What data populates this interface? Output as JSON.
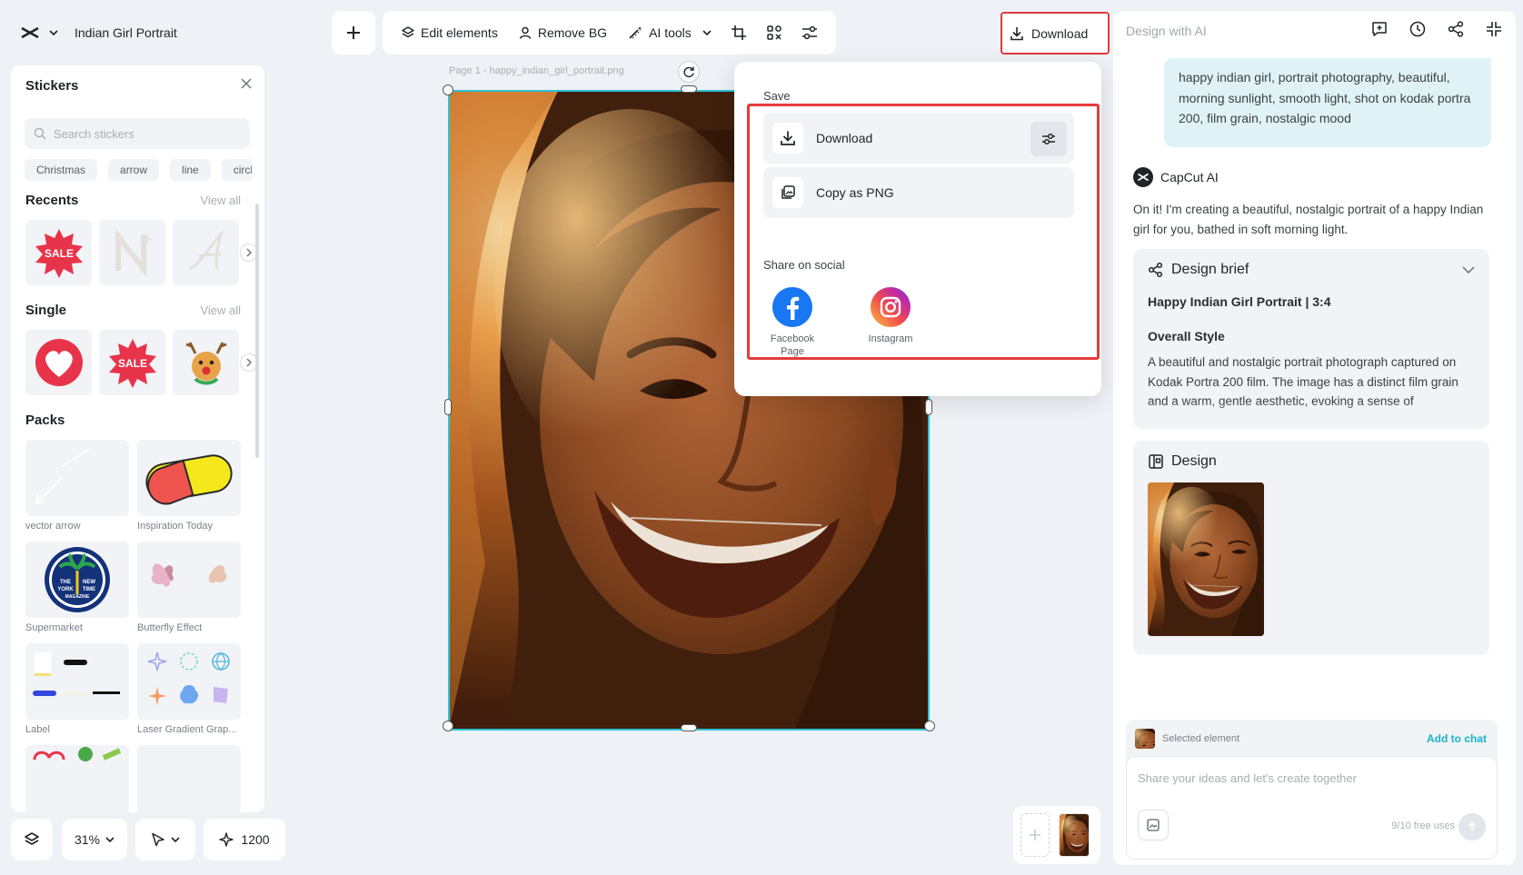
{
  "project": {
    "name": "Indian Girl Portrait"
  },
  "toolbar": {
    "edit_elements": "Edit elements",
    "remove_bg": "Remove BG",
    "ai_tools": "AI tools",
    "download": "Download"
  },
  "right_panel": {
    "title": "Design with AI",
    "user_prompt": "happy indian girl, portrait photography, beautiful, morning sunlight, smooth light, shot on kodak portra 200, film grain, nostalgic mood",
    "ai_name": "CapCut AI",
    "ai_message": "On it! I'm creating a beautiful, nostalgic portrait of a happy Indian girl for you, bathed in soft morning light.",
    "brief": {
      "title": "Design brief",
      "subtitle": "Happy Indian Girl Portrait | 3:4",
      "style_heading": "Overall Style",
      "style_text": "A beautiful and nostalgic portrait photograph captured on Kodak Portra 200 film. The image has a distinct film grain and a warm, gentle aesthetic, evoking a sense of"
    },
    "design": {
      "title": "Design"
    },
    "chat": {
      "selected_element": "Selected element",
      "add_to_chat": "Add to chat",
      "placeholder": "Share your ideas and let's create together",
      "free_uses": "9/10 free uses"
    }
  },
  "stickers": {
    "title": "Stickers",
    "search_placeholder": "Search stickers",
    "tags": [
      "Christmas",
      "arrow",
      "line",
      "circle"
    ],
    "recents": {
      "title": "Recents",
      "view_all": "View all",
      "sale_text": "SALE"
    },
    "single": {
      "title": "Single",
      "view_all": "View all",
      "sale_text": "SALE"
    },
    "packs": {
      "title": "Packs",
      "items": [
        "vector arrow",
        "Inspiration Today",
        "Supermarket",
        "Butterfly Effect",
        "Label",
        "Laser Gradient Grap..."
      ],
      "badge_text": [
        "THE",
        "NEW",
        "YORK",
        "TIME",
        "MAGAZINE"
      ]
    }
  },
  "bottom_controls": {
    "zoom": "31%",
    "credits": "1200"
  },
  "canvas": {
    "page_label": "Page 1 -   happy_indian_girl_portrait.png"
  },
  "download_popover": {
    "save_heading": "Save",
    "download": "Download",
    "copy_png": "Copy as PNG",
    "share_heading": "Share on social",
    "facebook": "Facebook Page",
    "instagram": "Instagram"
  },
  "colors": {
    "accent": "#1ab3cc",
    "selection": "#2cc3d6",
    "highlight_red": "#e33b3b",
    "facebook": "#1877f2"
  }
}
